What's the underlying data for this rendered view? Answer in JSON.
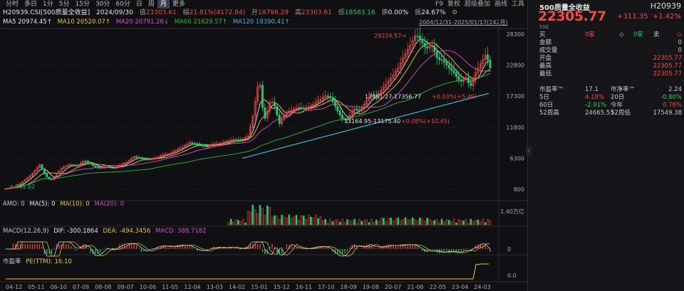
{
  "toolbar": {
    "tabs": [
      "分时",
      "多日",
      "1分",
      "5分",
      "15分",
      "30分",
      "60分",
      "日",
      "周",
      "月",
      "更多"
    ],
    "active": "月",
    "right": [
      "F9",
      "复权",
      "超级叠加",
      "画线",
      "工具"
    ]
  },
  "info": {
    "name": "H20939.CSI[500质量全收益]",
    "date": "2024/09/30",
    "cur_label": "值",
    "cur": "23303.61",
    "amp_label": "幅",
    "amp": "21.81%(4172.84)",
    "open_label": "开",
    "open": "18798.29",
    "high_label": "高",
    "high": "23303.61",
    "low_label": "低",
    "low": "18583.16",
    "hands_label": "换",
    "hands": "0.00%",
    "range_label": "振",
    "range": "24.67%"
  },
  "ma": {
    "ma5": "MA5 20974.45↑",
    "ma10": "MA10 20520.07↑",
    "ma20": "MA20 20791.26↓",
    "ma60": "MA60 21629.57↑",
    "ma120": "MA120 18390.41↑",
    "range": "2004/12/31-2025/01/17(242月)"
  },
  "annotations": {
    "peak": "29224.57",
    "low1": "17351.27-17356.77",
    "low1_chg": "+0.03%(+5.49)",
    "low2": "13164.95-13175.40",
    "low2_chg": "+0.08%(+10.45)",
    "left_mark": "↗ 781.02"
  },
  "y_axis": [
    "28300",
    "22800",
    "17300",
    "11800",
    "6300",
    "800"
  ],
  "amo": {
    "label": "AMO: 0",
    "ma5": "MA(5): 0",
    "ma10": "MA(10): 0",
    "ma20": "MA(20): 0",
    "scale": "1.40万亿"
  },
  "macd": {
    "label": "MACD(12,26,9)",
    "dif": "DIF: -300.1864",
    "dea": "DEA: -494.3456",
    "macd": "MACD: 388.7182",
    "zero": "0"
  },
  "pe": {
    "label": "市盈率",
    "pe": "PE(TTM): 16.10",
    "scale": "0.0"
  },
  "x_axis": [
    "04-12",
    "05-11",
    "06-10",
    "07-09",
    "08-08",
    "09-07",
    "10-06",
    "11-05",
    "12-04",
    "13-03",
    "14-02",
    "15-01",
    "15-12",
    "16-11",
    "17-10",
    "18-09",
    "19-08",
    "20-07",
    "21-06",
    "22-05",
    "23-04",
    "24-03"
  ],
  "side": {
    "title": "500质量全收益",
    "code": "H20939",
    "price": "22305.77",
    "chg": "+311.35",
    "pct": "+1.42%",
    "exchange": "SSE",
    "buy_label": "买",
    "buy": "0家",
    "sell_label": "卖",
    "sell": "0家",
    "rows": [
      [
        "金额",
        "0"
      ],
      [
        "成交量",
        "0"
      ],
      [
        "开盘",
        "22305.77"
      ],
      [
        "最高",
        "22305.77"
      ],
      [
        "最低",
        "22305.77"
      ]
    ],
    "pe_label": "市盈率™",
    "pe_val": "17.1",
    "pb_label": "市净率™",
    "pb_val": "2.24",
    "p1": [
      "5日",
      "4.18%",
      "20日",
      "-0.80%"
    ],
    "p2": [
      "60日",
      "-2.91%",
      "今年",
      "0.76%"
    ],
    "p3": [
      "52周高",
      "24665.53",
      "52周低",
      "17549.38"
    ]
  },
  "colors": {
    "up": "#f14a4a",
    "down": "#28c76f",
    "ma5": "#e8e8e8",
    "ma10": "#e8c548",
    "ma20": "#d04fd0",
    "ma60": "#2db84a",
    "ma120": "#3fb8d8"
  }
}
